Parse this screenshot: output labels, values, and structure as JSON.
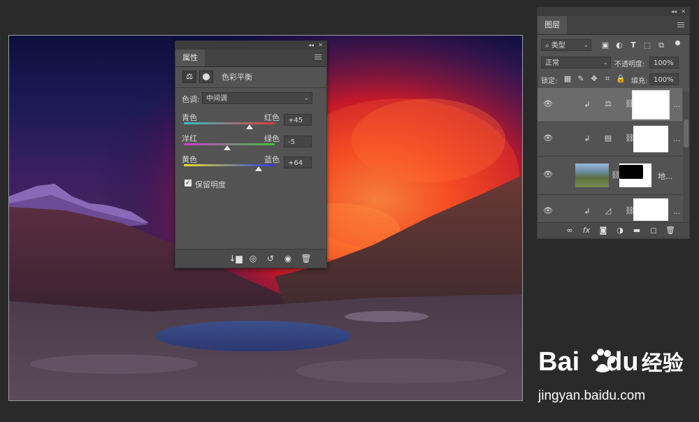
{
  "properties_panel": {
    "tab_label": "属性",
    "adjustment_title": "色彩平衡",
    "tone_label": "色调:",
    "tone_value": "中间调",
    "sliders": [
      {
        "left": "青色",
        "right": "红色",
        "value": "+45",
        "level": 0.725
      },
      {
        "left": "洋红",
        "right": "绿色",
        "value": "-5",
        "level": 0.475
      },
      {
        "left": "黄色",
        "right": "蓝色",
        "value": "+64",
        "level": 0.82
      }
    ],
    "preserve_luminosity_label": "保留明度",
    "preserve_luminosity_checked": true,
    "footer_icons": [
      "clip-to-layer-icon",
      "view-previous-icon",
      "reset-icon",
      "visibility-icon",
      "delete-icon"
    ]
  },
  "layers_panel": {
    "tab_label": "图层",
    "filter_kind": "类型",
    "blend_mode": "正常",
    "opacity_label": "不透明度:",
    "opacity_value": "100%",
    "lock_label": "锁定:",
    "fill_label": "填充:",
    "fill_value": "100%",
    "layers": [
      {
        "type": "color-balance",
        "name": "...",
        "selected": true
      },
      {
        "type": "levels",
        "name": "...",
        "selected": false
      },
      {
        "type": "image",
        "name": "地...",
        "selected": false
      },
      {
        "type": "curves",
        "name": "...",
        "selected": false
      }
    ],
    "footer_icons": [
      "link-icon",
      "fx-icon",
      "mask-icon",
      "adjustment-icon",
      "folder-icon",
      "new-layer-icon",
      "trash-icon"
    ]
  },
  "watermark": {
    "brand": "Bai",
    "brand_du": "du",
    "brand_cn": "经验",
    "url": "jingyan.baidu.com"
  }
}
